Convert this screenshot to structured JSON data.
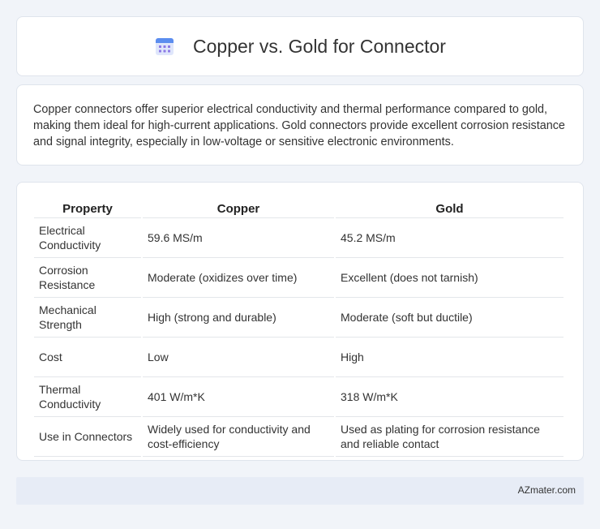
{
  "header": {
    "title": "Copper vs. Gold for Connector",
    "icon": "calendar-icon"
  },
  "intro": {
    "text": "Copper connectors offer superior electrical conductivity and thermal performance compared to gold, making them ideal for high-current applications. Gold connectors provide excellent corrosion resistance and signal integrity, especially in low-voltage or sensitive electronic environments."
  },
  "table": {
    "headers": [
      "Property",
      "Copper",
      "Gold"
    ],
    "rows": [
      [
        "Electrical Conductivity",
        "59.6 MS/m",
        "45.2 MS/m"
      ],
      [
        "Corrosion Resistance",
        "Moderate (oxidizes over time)",
        "Excellent (does not tarnish)"
      ],
      [
        "Mechanical Strength",
        "High (strong and durable)",
        "Moderate (soft but ductile)"
      ],
      [
        "Cost",
        "Low",
        "High"
      ],
      [
        "Thermal Conductivity",
        "401 W/m*K",
        "318 W/m*K"
      ],
      [
        "Use in Connectors",
        "Widely used for conductivity and cost-efficiency",
        "Used as plating for corrosion resistance and reliable contact"
      ]
    ]
  },
  "footer": {
    "brand": "AZmater.com"
  },
  "colors": {
    "background": "#f1f4f9",
    "icon_blue": "#5b8def",
    "icon_purple": "#8c7ae6",
    "footer_bg": "#e7ecf6"
  }
}
